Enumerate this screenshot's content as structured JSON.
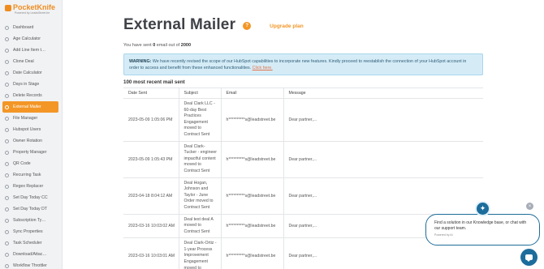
{
  "brand": {
    "name": "PocketKnife",
    "tagline": "Powered by LeadsStreet.be",
    "accent": "#f39626",
    "chat_color": "#1c6d9c"
  },
  "sidebar": {
    "items": [
      {
        "label": "Dashboard",
        "icon": "dashboard-icon"
      },
      {
        "label": "Age Calculator",
        "icon": "clock-icon"
      },
      {
        "label": "Add Line Item t…",
        "icon": "plus-icon"
      },
      {
        "label": "Clone Deal",
        "icon": "copy-icon"
      },
      {
        "label": "Date Calculator",
        "icon": "calendar-icon"
      },
      {
        "label": "Days in Stage",
        "icon": "hourglass-icon"
      },
      {
        "label": "Delete Records",
        "icon": "trash-icon"
      },
      {
        "label": "External Mailer",
        "icon": "mail-icon",
        "active": true
      },
      {
        "label": "File Manager",
        "icon": "folder-icon"
      },
      {
        "label": "Hubspot Users",
        "icon": "users-icon"
      },
      {
        "label": "Owner Rotation",
        "icon": "rotate-icon"
      },
      {
        "label": "Property Manager",
        "icon": "list-icon"
      },
      {
        "label": "QR Code",
        "icon": "qr-icon"
      },
      {
        "label": "Recurring Task",
        "icon": "repeat-icon"
      },
      {
        "label": "Regex Replacer",
        "icon": "regex-icon"
      },
      {
        "label": "Set Day Today CC",
        "icon": "calendar-icon"
      },
      {
        "label": "Set Day Today DT",
        "icon": "calendar-icon"
      },
      {
        "label": "Subscription Ty…",
        "icon": "tag-icon"
      },
      {
        "label": "Sync Properties",
        "icon": "sync-icon"
      },
      {
        "label": "Task Scheduler",
        "icon": "task-icon"
      },
      {
        "label": "Download/Attac…",
        "icon": "download-icon"
      },
      {
        "label": "Workflow Throttler",
        "icon": "workflow-icon"
      }
    ]
  },
  "header": {
    "title": "External Mailer",
    "badge": "?",
    "upgrade_label": "Upgrade plan"
  },
  "sent_info": {
    "prefix": "You have sent",
    "count": "0",
    "middle": "email out of",
    "limit": "2000"
  },
  "warning": {
    "label": "WARNING:",
    "text": "We have recently revised the scope of our HubSpot capabilities to incorporate new features. Kindly proceed to reestablish the connection of your HubSpot account in order to access and benefit from these enhanced functionalities.",
    "link": "Click here."
  },
  "table": {
    "section_title": "100 most recent mail sent",
    "columns": [
      "Date Sent",
      "Subject",
      "Email",
      "Message"
    ],
    "rows": [
      {
        "date": "2023-05-09 1:05:06 PM",
        "subject": "Deal Clark LLC - 60-day Best Practices Engagement moved to Contract Sent",
        "email": "h**********s@leadstreet.be",
        "message": "Dear partner,..."
      },
      {
        "date": "2023-05-09 1:05:43 PM",
        "subject": "Deal Clark-Tucker - engineer impactful content moved to Contract Sent",
        "email": "h**********s@leadstreet.be",
        "message": "Dear partner,..."
      },
      {
        "date": "2023-04-18 8:04:12 AM",
        "subject": "Deal Hogan, Johnson and Taylor - June Order moved to Contract Sent",
        "email": "h**********s@leadstreet.be",
        "message": "Dear partner,..."
      },
      {
        "date": "2023-03-16 10:03:02 AM",
        "subject": "Deal test deal A moved to Contract Sent",
        "email": "h**********s@leadstreet.be",
        "message": "Dear partner,..."
      },
      {
        "date": "2023-03-16 10:03:01 AM",
        "subject": "Deal Clark-Ortiz - 1-year Process Improvement Engagement moved to",
        "email": "h**********s@leadstreet.be",
        "message": "Dear partner,..."
      }
    ]
  },
  "chat": {
    "text": "Find a solution in our Knowledge base, or chat with our support team.",
    "powered": "Powered by AI",
    "close": "×",
    "avatar_icon": "sparkle-icon"
  }
}
